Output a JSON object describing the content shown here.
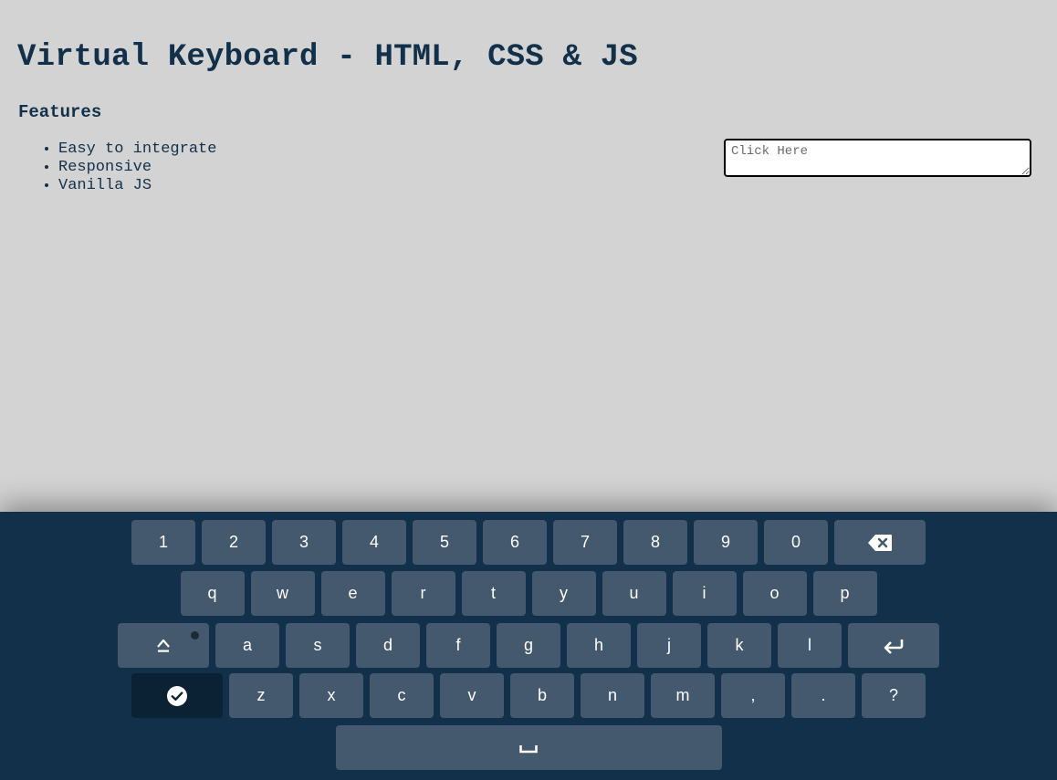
{
  "page": {
    "title": "Virtual Keyboard - HTML, CSS & JS",
    "features_heading": "Features",
    "features": [
      "Easy to integrate",
      "Responsive",
      "Vanilla JS"
    ]
  },
  "input": {
    "placeholder": "Click Here",
    "value": ""
  },
  "keyboard": {
    "row1": [
      "1",
      "2",
      "3",
      "4",
      "5",
      "6",
      "7",
      "8",
      "9",
      "0"
    ],
    "row2": [
      "q",
      "w",
      "e",
      "r",
      "t",
      "y",
      "u",
      "i",
      "o",
      "p"
    ],
    "row3": [
      "a",
      "s",
      "d",
      "f",
      "g",
      "h",
      "j",
      "k",
      "l"
    ],
    "row4": [
      "z",
      "x",
      "c",
      "v",
      "b",
      "n",
      "m",
      ",",
      ".",
      "?"
    ],
    "special_icons": {
      "backspace": "backspace-icon",
      "caps": "caps-lock-icon",
      "enter": "enter-icon",
      "done": "check-circle-icon",
      "space": "space-bar-icon"
    },
    "colors": {
      "background": "#12304a",
      "key": "#44596e",
      "key_dark": "#0b2234",
      "key_text": "#ffffff"
    }
  }
}
